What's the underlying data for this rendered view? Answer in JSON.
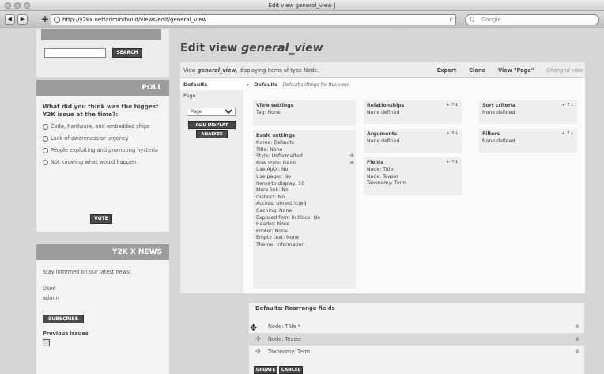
{
  "browser": {
    "window_title": "Edit view general_view |",
    "url": "http://y2kx.net/admin/build/views/edit/general_view",
    "search_placeholder": "Google",
    "back_icon": "back-arrow-icon",
    "forward_icon": "forward-arrow-icon"
  },
  "sidebar": {
    "search_button": "SEARCH",
    "poll": {
      "title": "POLL",
      "question": "What did you think was the biggest Y2K issue at the time?:",
      "options": [
        "Code, hardware, and embedded chips",
        "Lack of awareness or urgency",
        "People exploiting and promoting hysteria",
        "Not knowing what would happen"
      ],
      "vote_button": "VOTE"
    },
    "news": {
      "title": "Y2K X NEWS",
      "intro": "Stay informed on our latest news!",
      "user_label": "User:",
      "user_value": "admin",
      "subscribe_button": "SUBSCRIBE",
      "previous_issues": "Previous issues"
    }
  },
  "main": {
    "title_prefix": "Edit view ",
    "title_view": "general_view",
    "view_desc_prefix": "View ",
    "view_desc_name": "general_view",
    "view_desc_suffix": ", displaying items of type Node.",
    "links": {
      "export": "Export",
      "clone": "Clone",
      "view_page": "View \"Page\"",
      "changed": "Changed view"
    },
    "displays": {
      "defaults_label": "Defaults",
      "page_label": "Page",
      "select_value": "Page",
      "add_display_button": "ADD DISPLAY",
      "analyze_button": "ANALYZE"
    },
    "defaults_header": {
      "arrow": "▸",
      "title": "Defaults",
      "subtitle": "Default settings for this view."
    },
    "view_settings": {
      "title": "View settings",
      "rows": [
        "Tag: None"
      ]
    },
    "basic_settings": {
      "title": "Basic settings",
      "rows": [
        "Name: Defaults",
        "Title: None",
        "Style: Unformatted",
        "Row style: Fields",
        "Use AJAX: No",
        "Use pager: No",
        "Items to display: 10",
        "More link: No",
        "Distinct: No",
        "Access: Unrestricted",
        "Caching: None",
        "Exposed form in block: No",
        "Header: None",
        "Footer: None",
        "Empty text: None",
        "Theme: Information"
      ]
    },
    "relationships": {
      "title": "Relationships",
      "rows": [
        "None defined"
      ]
    },
    "arguments": {
      "title": "Arguments",
      "rows": [
        "None defined"
      ]
    },
    "fields": {
      "title": "Fields",
      "rows": [
        "Node: Title",
        "Node: Teaser",
        "Taxonomy: Term"
      ]
    },
    "sort_criteria": {
      "title": "Sort criteria",
      "rows": [
        "None defined"
      ]
    },
    "filters": {
      "title": "Filters",
      "rows": [
        "None defined"
      ]
    },
    "tools_label": "+ ↑↓",
    "rearrange": {
      "title": "Defaults: Rearrange fields",
      "rows": [
        "Node: Title *",
        "Node: Teaser",
        "Taxonomy: Term"
      ],
      "update_button": "UPDATE",
      "cancel_button": "CANCEL"
    }
  }
}
